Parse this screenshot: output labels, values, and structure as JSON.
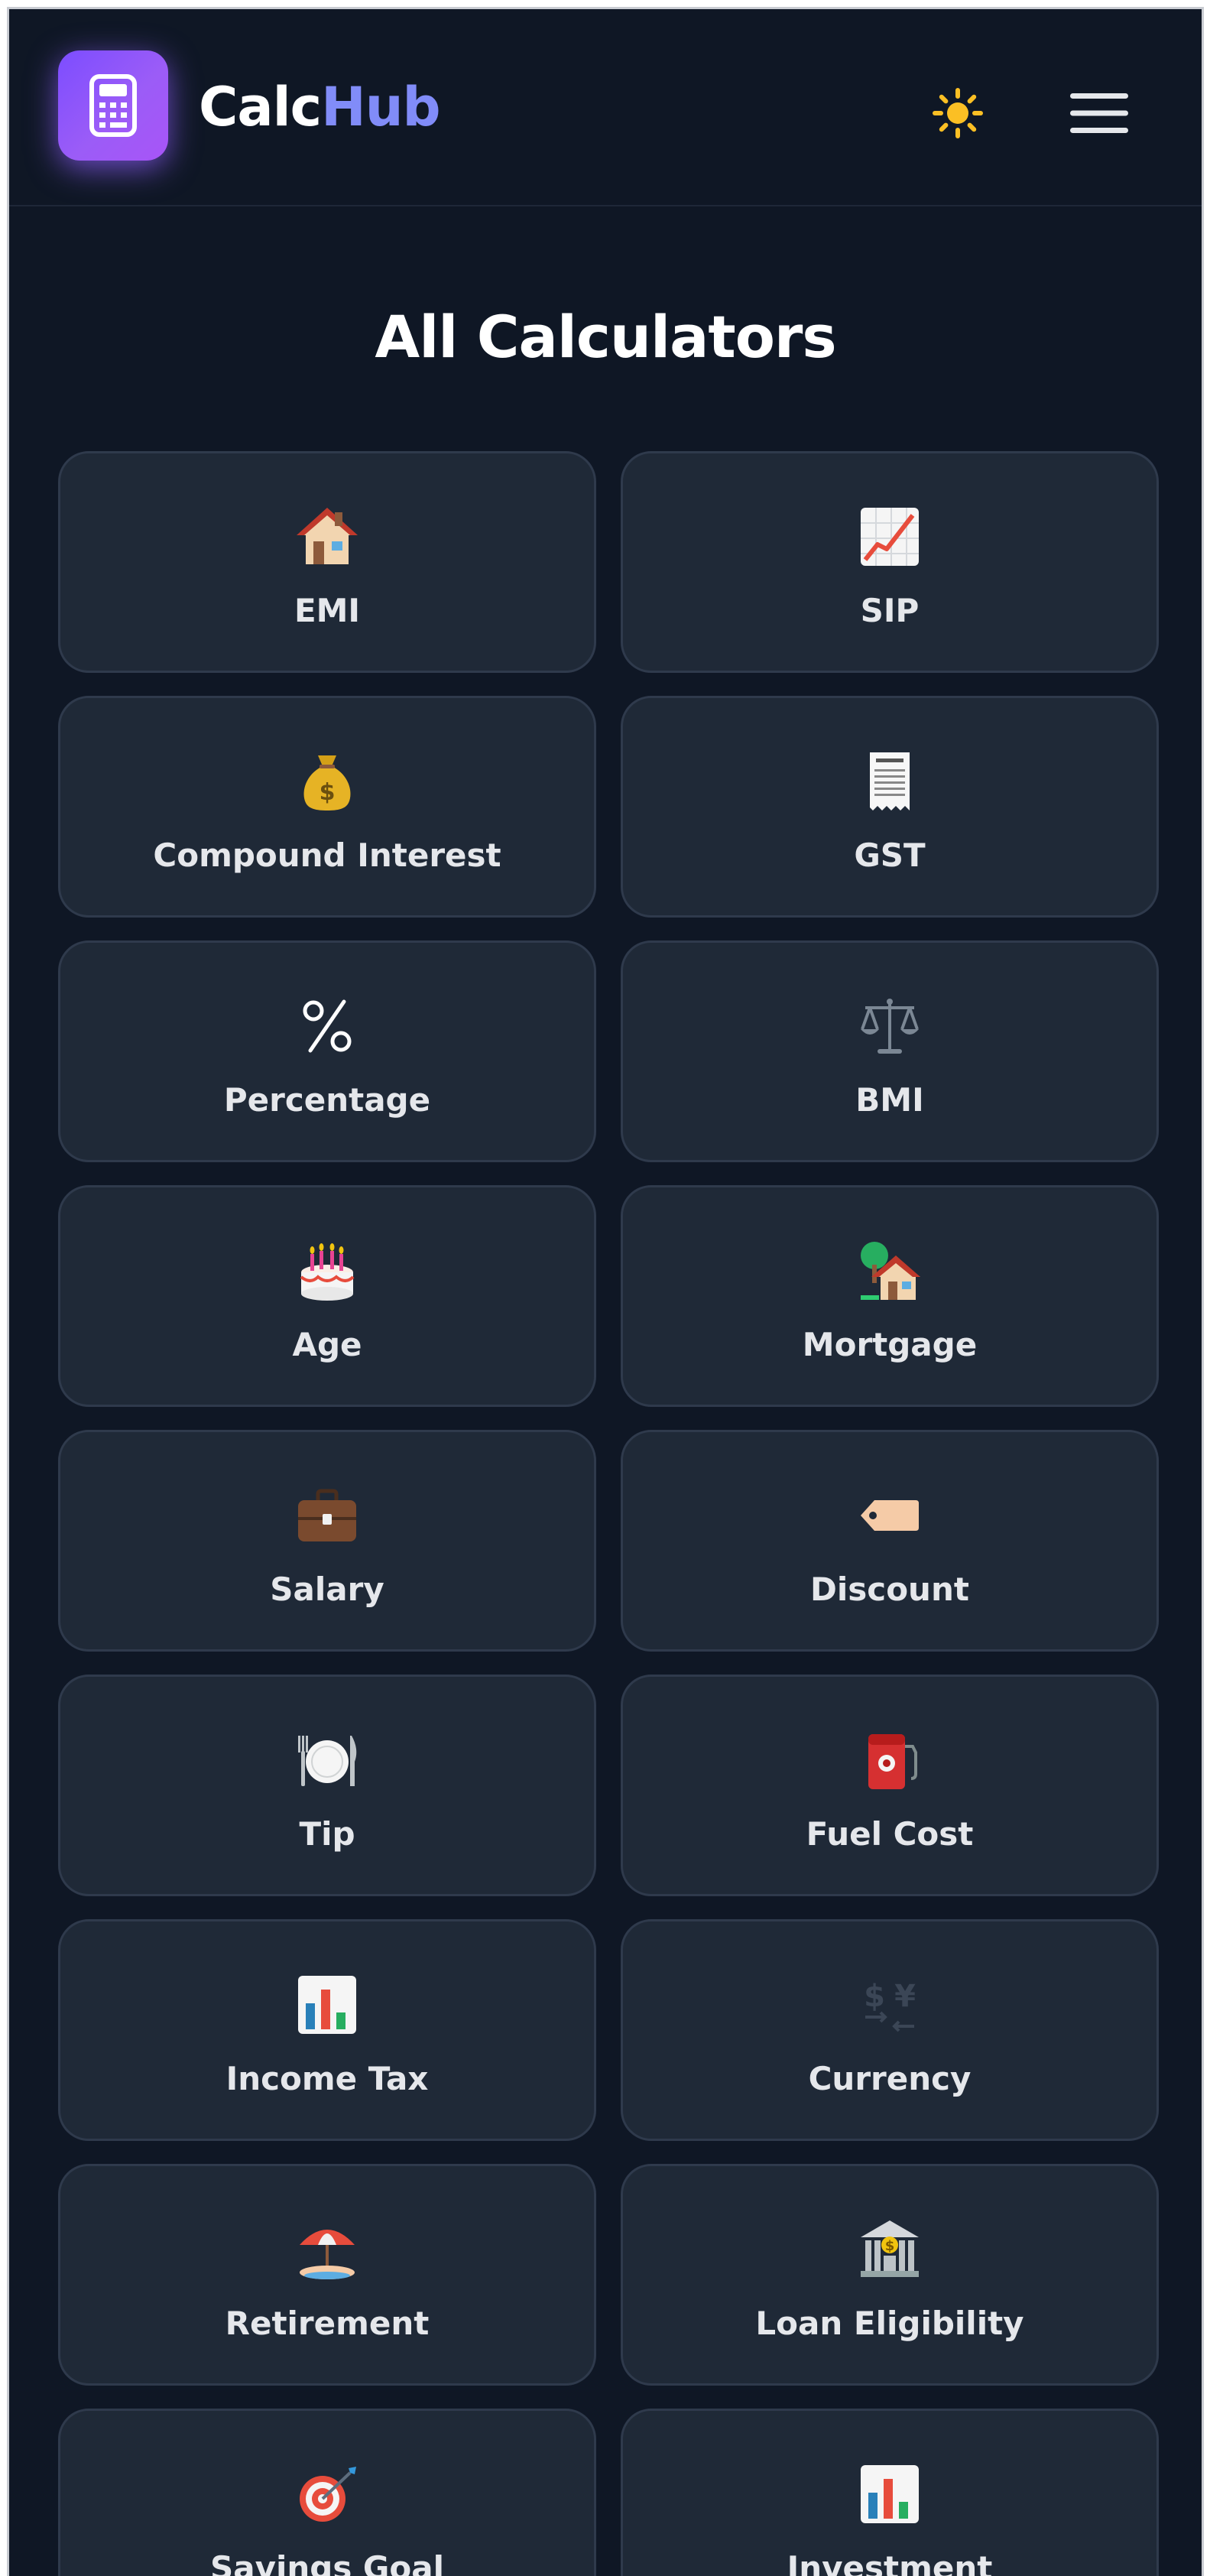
{
  "header": {
    "brand_part1": "Calc",
    "brand_part2": "Hub",
    "logo_icon": "calculator-icon",
    "theme_icon": "sun-icon",
    "menu_icon": "hamburger-menu-icon"
  },
  "main": {
    "title": "All Calculators"
  },
  "calculators": [
    {
      "label": "EMI",
      "icon": "house-icon"
    },
    {
      "label": "SIP",
      "icon": "chart-increasing-icon"
    },
    {
      "label": "Compound Interest",
      "icon": "money-bag-icon"
    },
    {
      "label": "GST",
      "icon": "receipt-icon"
    },
    {
      "label": "Percentage",
      "icon": "percent-icon"
    },
    {
      "label": "BMI",
      "icon": "balance-scale-icon"
    },
    {
      "label": "Age",
      "icon": "birthday-cake-icon"
    },
    {
      "label": "Mortgage",
      "icon": "house-with-garden-icon"
    },
    {
      "label": "Salary",
      "icon": "briefcase-icon"
    },
    {
      "label": "Discount",
      "icon": "tag-icon"
    },
    {
      "label": "Tip",
      "icon": "plate-cutlery-icon"
    },
    {
      "label": "Fuel Cost",
      "icon": "fuel-pump-icon"
    },
    {
      "label": "Income Tax",
      "icon": "bar-chart-icon"
    },
    {
      "label": "Currency",
      "icon": "currency-exchange-icon"
    },
    {
      "label": "Retirement",
      "icon": "beach-umbrella-icon"
    },
    {
      "label": "Loan Eligibility",
      "icon": "bank-icon"
    },
    {
      "label": "Savings Goal",
      "icon": "target-icon"
    },
    {
      "label": "Investment",
      "icon": "bar-chart-icon"
    }
  ],
  "colors": {
    "background": "#0f1725",
    "card": "#1f2937",
    "accent": "#818cf8",
    "logo": "#8b5cf6",
    "sun": "#fbbf24"
  }
}
